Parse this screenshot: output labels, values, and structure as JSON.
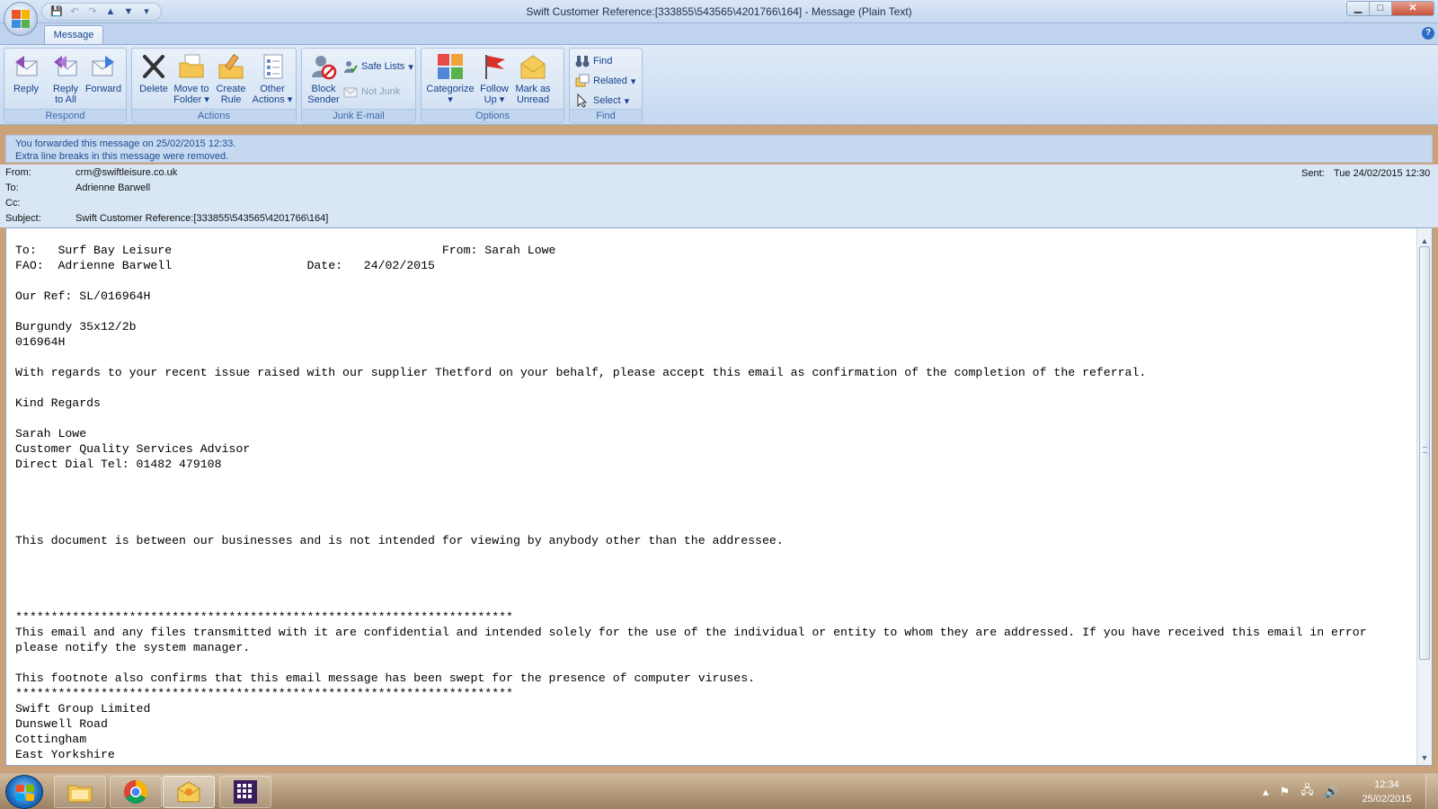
{
  "window": {
    "title": "Swift Customer Reference:[333855\\543565\\4201766\\164] - Message (Plain Text)",
    "minimize": "▁",
    "maximize": "□",
    "close": "✕"
  },
  "ribbon": {
    "tab": "Message",
    "groups": {
      "respond": {
        "label": "Respond",
        "reply": "Reply",
        "reply_all_1": "Reply",
        "reply_all_2": "to All",
        "forward": "Forward"
      },
      "actions": {
        "label": "Actions",
        "delete": "Delete",
        "move_1": "Move to",
        "move_2": "Folder",
        "create_1": "Create",
        "create_2": "Rule",
        "other_1": "Other",
        "other_2": "Actions"
      },
      "junk": {
        "label": "Junk E-mail",
        "block_1": "Block",
        "block_2": "Sender",
        "safe_lists": "Safe Lists",
        "not_junk": "Not Junk"
      },
      "options": {
        "label": "Options",
        "categorize": "Categorize",
        "follow_1": "Follow",
        "follow_2": "Up",
        "mark_1": "Mark as",
        "mark_2": "Unread"
      },
      "find": {
        "label": "Find",
        "find": "Find",
        "related": "Related",
        "select": "Select"
      }
    }
  },
  "infobar": {
    "line1": "You forwarded this message on 25/02/2015 12:33.",
    "line2": "Extra line breaks in this message were removed."
  },
  "headers": {
    "from_label": "From:",
    "from": "crm@swiftleisure.co.uk",
    "to_label": "To:",
    "to": "Adrienne Barwell",
    "cc_label": "Cc:",
    "cc": "",
    "subject_label": "Subject:",
    "subject": "Swift Customer Reference:[333855\\543565\\4201766\\164]",
    "sent_label": "Sent:",
    "sent": "Tue 24/02/2015 12:30"
  },
  "body": {
    "text": "To:   Surf Bay Leisure                                      From: Sarah Lowe\nFAO:  Adrienne Barwell                   Date:   24/02/2015\n\nOur Ref: SL/016964H\n\nBurgundy 35x12/2b\n016964H\n\nWith regards to your recent issue raised with our supplier Thetford on your behalf, please accept this email as confirmation of the completion of the referral.\n\nKind Regards\n\nSarah Lowe\nCustomer Quality Services Advisor\nDirect Dial Tel: 01482 479108\n\n\n\n\nThis document is between our businesses and is not intended for viewing by anybody other than the addressee.\n\n\n\n\n**********************************************************************\nThis email and any files transmitted with it are confidential and intended solely for the use of the individual or entity to whom they are addressed. If you have received this email in error\nplease notify the system manager.\n\nThis footnote also confirms that this email message has been swept for the presence of computer viruses.\n**********************************************************************\nSwift Group Limited\nDunswell Road\nCottingham\nEast Yorkshire"
  },
  "taskbar": {
    "time": "12:34",
    "date": "25/02/2015"
  }
}
